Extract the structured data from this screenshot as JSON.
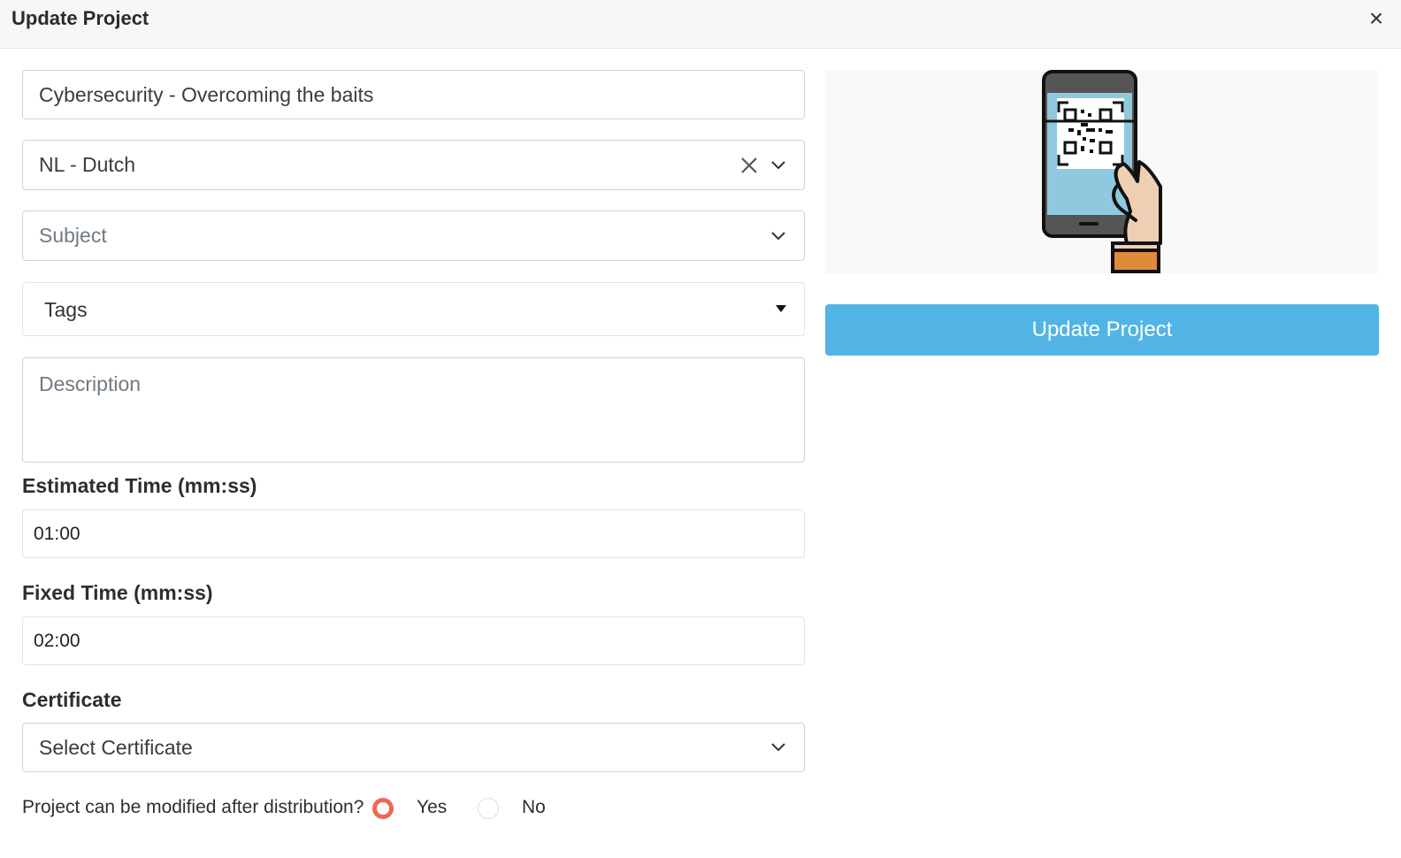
{
  "dialog": {
    "title": "Update Project",
    "close_glyph": "×"
  },
  "form": {
    "project_title": "Cybersecurity - Overcoming the baits",
    "language": "NL - Dutch",
    "subject_placeholder": "Subject",
    "tags_placeholder": "Tags",
    "description_placeholder": "Description",
    "estimated_time_label": "Estimated Time (mm:ss)",
    "estimated_time_value": "01:00",
    "fixed_time_label": "Fixed Time (mm:ss)",
    "fixed_time_value": "02:00",
    "certificate_label": "Certificate",
    "certificate_placeholder": "Select Certificate",
    "modifiable_question": "Project can be modified after distribution?",
    "modifiable_options": [
      "Yes",
      "No"
    ],
    "modifiable_selected": "Yes"
  },
  "sidebar": {
    "image_icon": "phone-qr-scan-icon",
    "update_button_label": "Update Project"
  },
  "colors": {
    "primary_button": "#52b4e5",
    "radio_selected": "#ec6a55",
    "phone_screen": "#8ec9df",
    "skin": "#efcfb3",
    "sleeve": "#e08a3c"
  }
}
